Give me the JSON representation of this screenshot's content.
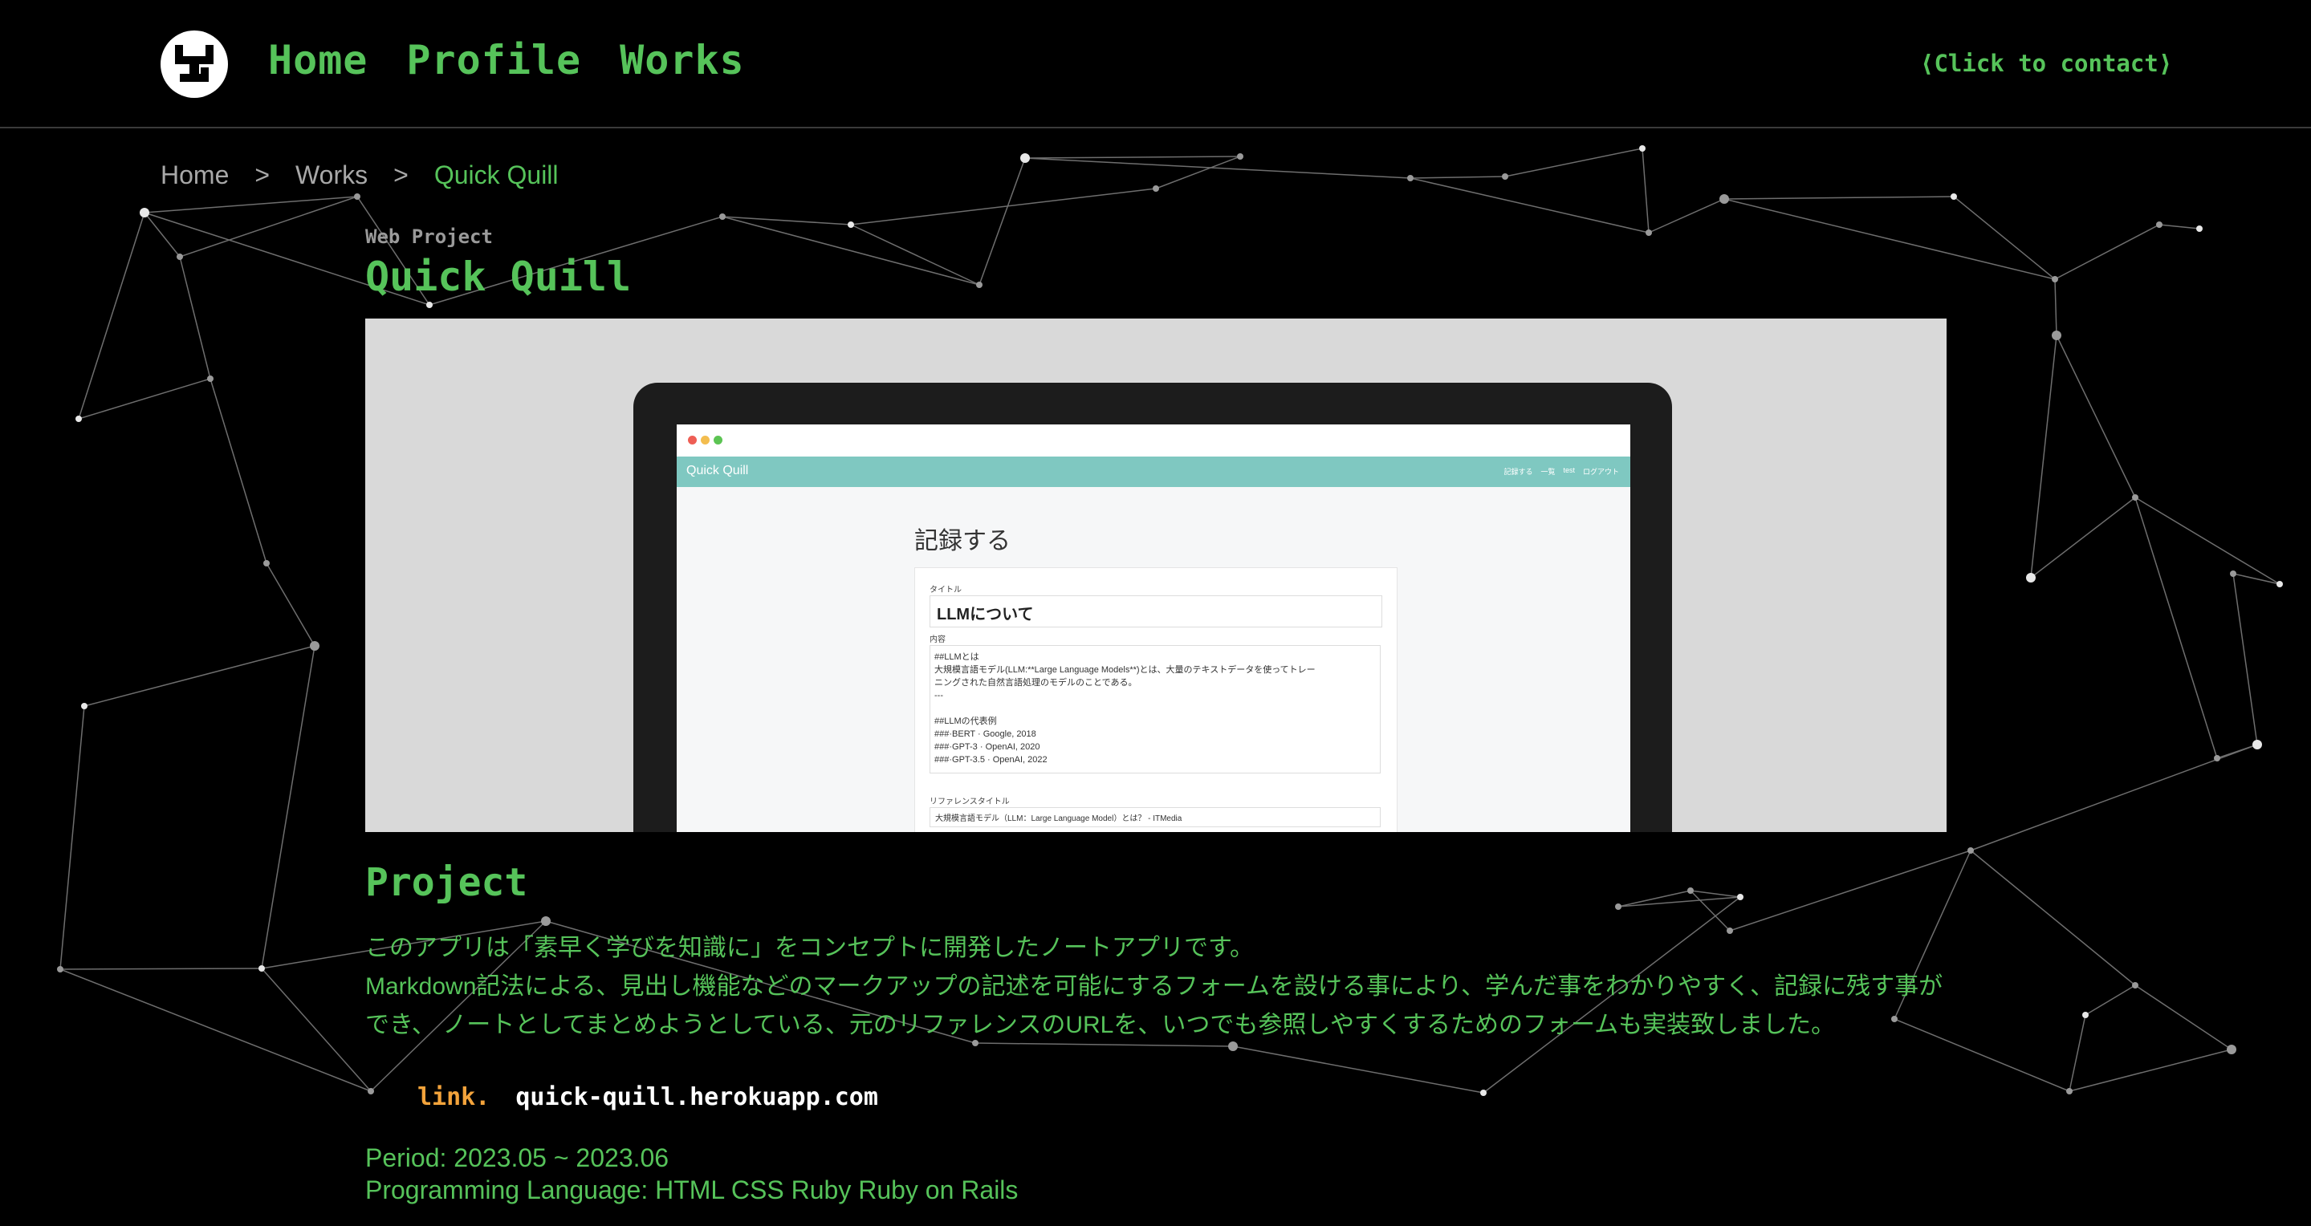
{
  "header": {
    "nav": [
      "Home",
      "Profile",
      "Works"
    ],
    "contact": "⟨Click to contact⟩"
  },
  "breadcrumb": {
    "items": [
      "Home",
      "Works",
      "Quick Quill"
    ],
    "separator": ">"
  },
  "work": {
    "category": "Web Project",
    "title": "Quick Quill"
  },
  "screenshot": {
    "app_name": "Quick Quill",
    "menu": [
      "記録する",
      "一覧",
      "test",
      "ログアウト"
    ],
    "heading": "記録する",
    "title_label": "タイトル",
    "title_value": "LLMについて",
    "content_label": "内容",
    "content_lines": [
      "##LLMとは",
      "大規模言語モデル(LLM:**Large Language Models**)とは、大量のテキストデータを使ってトレー",
      "ニングされた自然言語処理のモデルのことである。",
      "---",
      "",
      "##LLMの代表例",
      "###·BERT · Google, 2018",
      "###·GPT-3 · OpenAI, 2020",
      "###·GPT-3.5 · OpenAI, 2022"
    ],
    "reference_label": "リファレンスタイトル",
    "reference_value": "大規模言語モデル（LLM：Large Language Model）とは？ - ITMedia"
  },
  "project": {
    "heading": "Project",
    "paragraphs": [
      "このアプリは「素早く学びを知識に」をコンセプトに開発したノートアプリです。",
      "Markdown記法による、見出し機能などのマークアップの記述を可能にするフォームを設ける事により、学んだ事をわかりやすく、記録に残す事ができ、 ノートとしてまとめようとしている、元のリファレンスのURLを、いつでも参照しやすくするためのフォームも実装致しました。"
    ],
    "link_label": "link.",
    "link_url": "quick-quill.herokuapp.com",
    "period": "Period: 2023.05 ~ 2023.06",
    "languages": "Programming Language: HTML CSS Ruby Ruby on Rails"
  },
  "colors": {
    "accent": "#56c35a",
    "background": "#000000",
    "link_label": "#f3a33b",
    "app_bar": "#7fc8c1"
  }
}
